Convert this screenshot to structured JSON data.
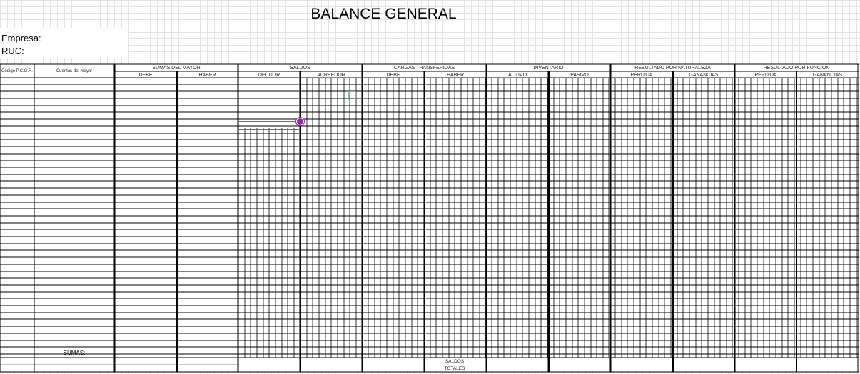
{
  "sheet": {
    "title": "BALANCE GENERAL",
    "empresa_label": "Empresa:",
    "ruc_label": "RUC:"
  },
  "columns": {
    "codigo": "Codigo P.C.G.R.",
    "cuentas": "Cuentas del mayor",
    "groups": [
      {
        "label": "SUMAS DEL MAYOR",
        "subs": [
          "DEBE",
          "HABER"
        ]
      },
      {
        "label": "SALDOS",
        "subs": [
          "DEUDOR",
          "ACREEDOR"
        ]
      },
      {
        "label": "CARGAS TRANSFERIDAS",
        "subs": [
          "DEBE",
          "HABER"
        ]
      },
      {
        "label": "INVENTARIO",
        "subs": [
          "ACTIVO",
          "PASIVO"
        ]
      },
      {
        "label": "RESULTADO POR NATURALEZA",
        "subs": [
          "PÉRDIDA",
          "GANANCIAS"
        ]
      },
      {
        "label": "RESULTADO POR FUNCIÓN",
        "subs": [
          "PÉRDIDA",
          "GANANCIAS"
        ]
      }
    ]
  },
  "footer": {
    "sumas": "SUMAS:",
    "saldos": "SALDOS",
    "totales": "TOTALES"
  },
  "colors": {
    "grid": "#e3e3e3",
    "rule": "#000000",
    "cursor": "#9b27af"
  }
}
